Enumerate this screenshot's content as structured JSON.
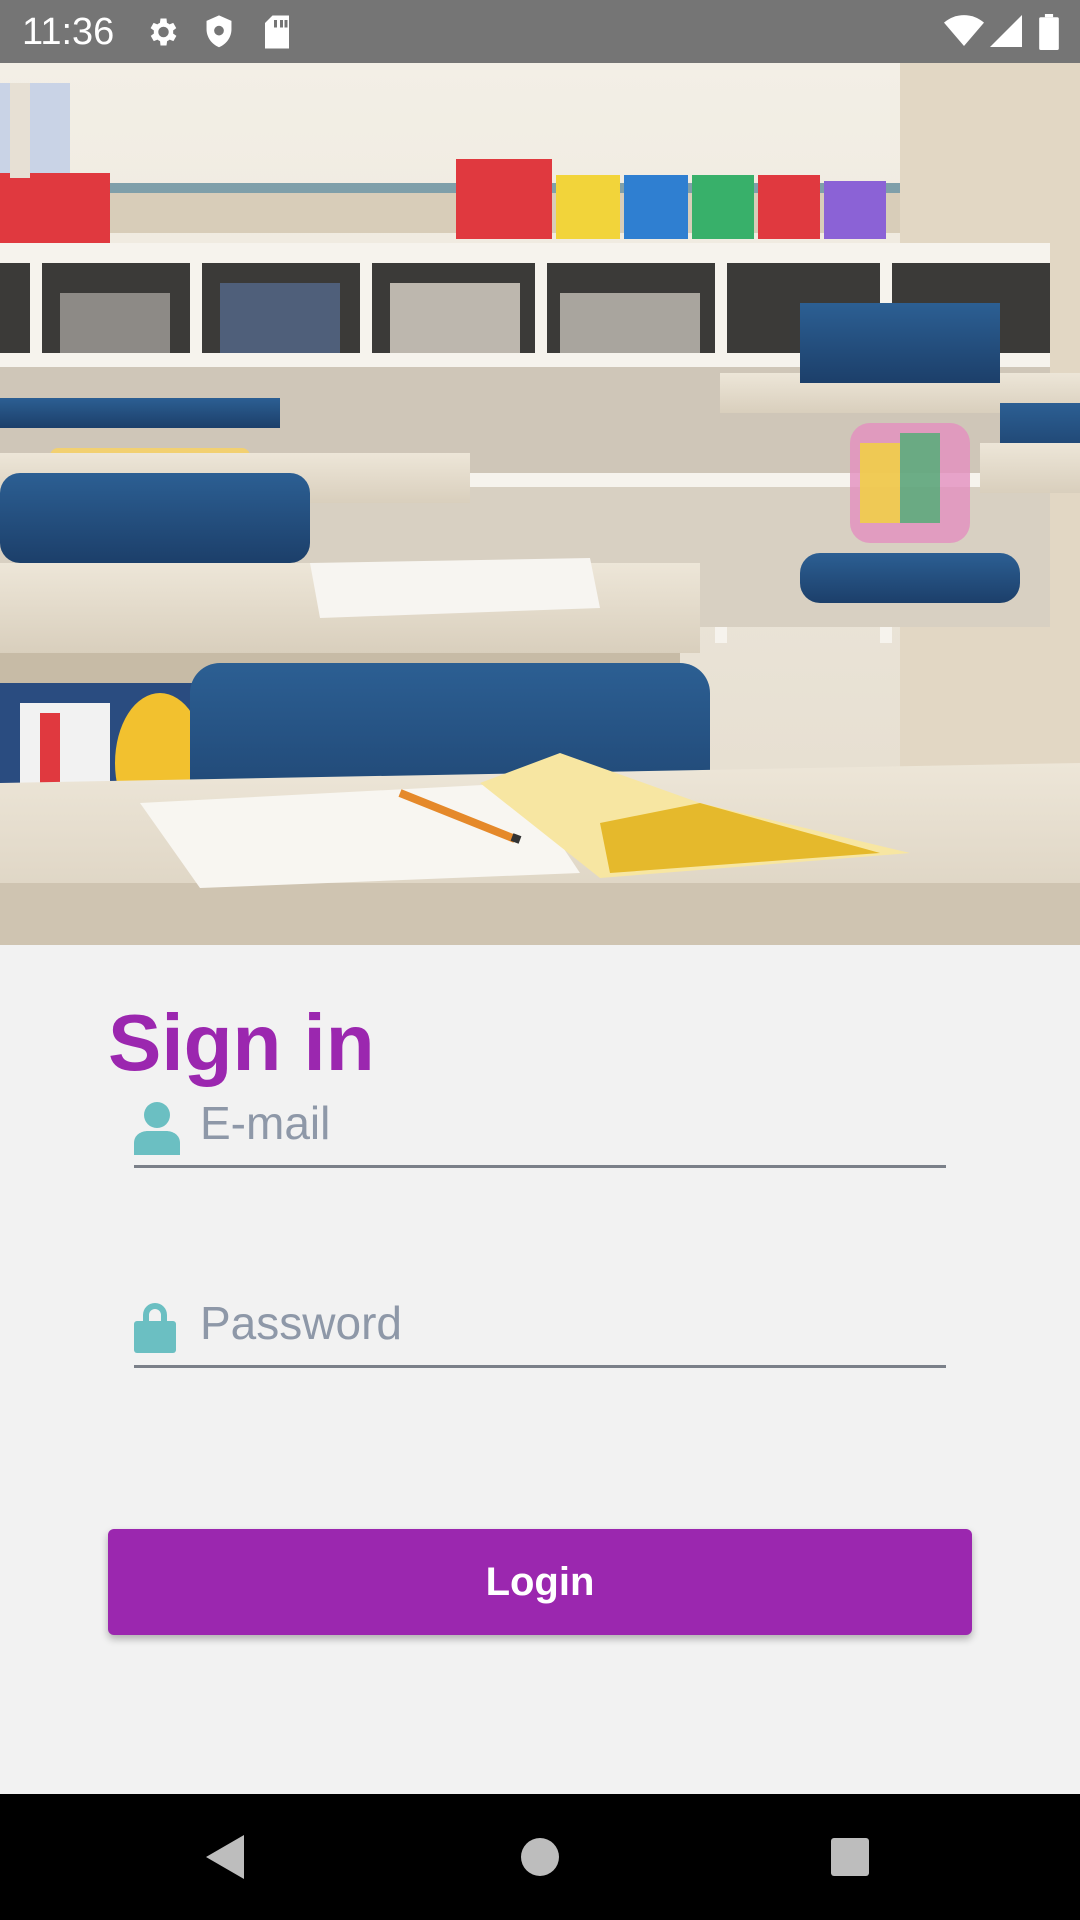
{
  "status_bar": {
    "time": "11:36",
    "left_icons": [
      "gear-icon",
      "shield-icon",
      "sd-card-icon"
    ],
    "right_icons": [
      "wifi-icon",
      "signal-icon",
      "battery-icon"
    ]
  },
  "hero": {
    "icon": "classroom-photo"
  },
  "signin": {
    "title": "Sign in",
    "email": {
      "placeholder": "E-mail",
      "value": "",
      "icon": "person-icon"
    },
    "password": {
      "placeholder": "Password",
      "value": "",
      "icon": "lock-icon"
    },
    "login_label": "Login"
  },
  "colors": {
    "accent": "#9b27af",
    "icon_tint": "#6bbfc2",
    "status_bar": "#757575",
    "background": "#f2f2f2"
  },
  "nav_bar": {
    "buttons": [
      "back-icon",
      "home-icon",
      "recents-icon"
    ]
  }
}
